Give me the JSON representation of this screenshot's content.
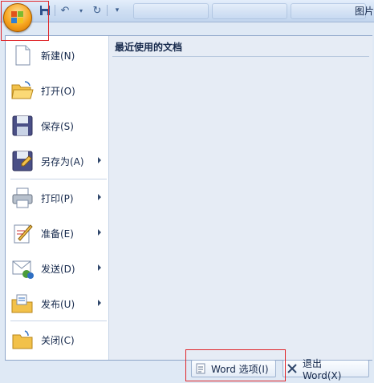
{
  "title_bar": {
    "right_text": "图片"
  },
  "quick_access": {
    "icons": [
      "save-icon",
      "undo-icon",
      "redo-icon",
      "customize-icon"
    ]
  },
  "menu": {
    "items": [
      {
        "label": "新建(N)",
        "icon": "new-document-icon",
        "submenu": false
      },
      {
        "label": "打开(O)",
        "icon": "open-folder-icon",
        "submenu": false
      },
      {
        "label": "保存(S)",
        "icon": "save-disk-icon",
        "submenu": false
      },
      {
        "label": "另存为(A)",
        "icon": "save-as-icon",
        "submenu": true
      },
      {
        "label": "打印(P)",
        "icon": "printer-icon",
        "submenu": true
      },
      {
        "label": "准备(E)",
        "icon": "prepare-icon",
        "submenu": true
      },
      {
        "label": "发送(D)",
        "icon": "send-icon",
        "submenu": true
      },
      {
        "label": "发布(U)",
        "icon": "publish-icon",
        "submenu": true
      },
      {
        "label": "关闭(C)",
        "icon": "close-folder-icon",
        "submenu": false
      }
    ]
  },
  "recent": {
    "title": "最近使用的文档"
  },
  "buttons": {
    "word_options": "Word 选项(I)",
    "exit_word": "退出 Word(X)"
  },
  "colors": {
    "accent_orange": "#f6a21a",
    "highlight_red": "#e0262a",
    "panel_border": "#8ea6c9"
  }
}
